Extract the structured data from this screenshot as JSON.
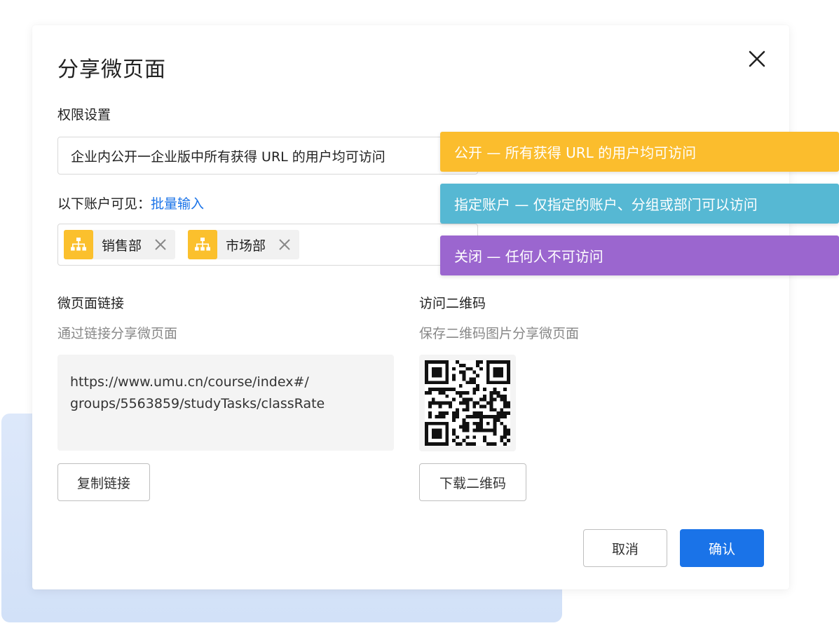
{
  "dialog": {
    "title": "分享微页面",
    "permission": {
      "label": "权限设置",
      "selected_value": "企业内公开一企业版中所有获得 URL 的用户均可访问"
    },
    "visibility": {
      "label": "以下账户可见：",
      "batch_link": "批量输入",
      "tags": [
        {
          "label": "销售部",
          "icon": "org-chart-icon"
        },
        {
          "label": "市场部",
          "icon": "org-chart-icon"
        }
      ]
    },
    "link_section": {
      "heading": "微页面链接",
      "description": "通过链接分享微页面",
      "url_line1": "https://www.umu.cn/course/index#/",
      "url_line2": "groups/5563859/studyTasks/classRate",
      "copy_button": "复制链接"
    },
    "qr_section": {
      "heading": "访问二维码",
      "description": "保存二维码图片分享微页面",
      "download_button": "下载二维码"
    },
    "footer": {
      "cancel_button": "取消",
      "confirm_button": "确认"
    }
  },
  "permission_options": [
    {
      "label": "公开 — 所有获得 URL 的用户均可访问",
      "color": "#fbbd2d"
    },
    {
      "label": "指定账户 — 仅指定的账户、分组或部门可以访问",
      "color": "#56b8d3"
    },
    {
      "label": "关闭 — 任何人不可访问",
      "color": "#9b66cf"
    }
  ],
  "colors": {
    "primary": "#1a73e8",
    "tag_icon_bg": "#fbc02d",
    "background_card": "#d6e4f9"
  }
}
